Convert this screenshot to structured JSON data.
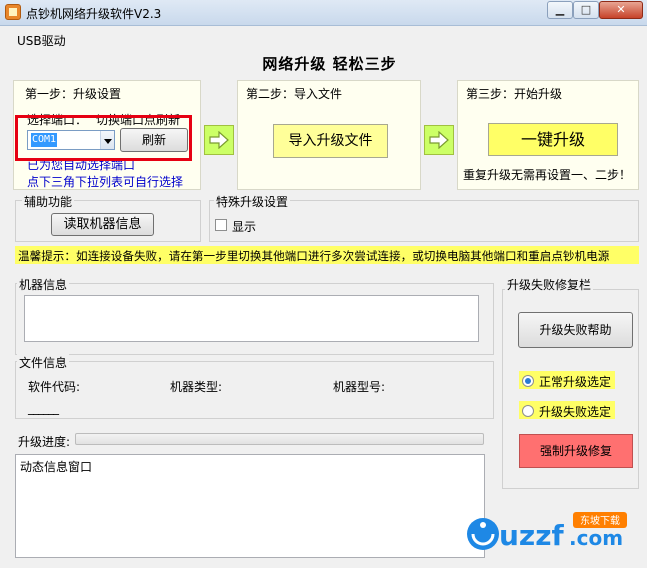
{
  "window": {
    "title": "点钞机网络升级软件V2.3",
    "buttons": [
      "minimize",
      "maximize",
      "close"
    ]
  },
  "menu": {
    "items": [
      "USB驱动"
    ]
  },
  "headline": "网络升级  轻松三步",
  "step1": {
    "title": "第一步：升级设置",
    "port_label": "选择端口：",
    "refresh_hint": "切换端口点刷新",
    "port_value": "COM1",
    "refresh_button": "刷新",
    "auto_select_note": "已为您自动选择端口",
    "dropdown_note": "点下三角下拉列表可自行选择"
  },
  "step2": {
    "title": "第二步：导入文件",
    "import_button": "导入升级文件"
  },
  "step3": {
    "title": "第三步：开始升级",
    "upgrade_button": "一键升级",
    "note": "重复升级无需再设置一、二步！"
  },
  "aux": {
    "title": "辅助功能",
    "read_button": "读取机器信息"
  },
  "special": {
    "title": "特殊升级设置",
    "show_label": "显示",
    "show_checked": false
  },
  "tip": "温馨提示：如连接设备失败，请在第一步里切换其他端口进行多次尝试连接，或切换电脑其他端口和重启点钞机电源",
  "machine_info": {
    "title": "机器信息",
    "content": ""
  },
  "file_info": {
    "title": "文件信息",
    "software_code_label": "软件代码:",
    "machine_type_label": "机器类型:",
    "machine_model_label": "机器型号:",
    "software_code_value": "______"
  },
  "progress": {
    "label": "升级进度:",
    "percent": 0
  },
  "dynamic": {
    "content": "动态信息窗口"
  },
  "repair": {
    "title": "升级失败修复栏",
    "help_button": "升级失败帮助",
    "normal_option": "正常升级选定",
    "fail_option": "升级失败选定",
    "selected": "normal",
    "force_button": "强制升级修复"
  },
  "watermark": {
    "text": "uzzf.com",
    "badge": "东坡下载"
  },
  "colors": {
    "step_bg": "#fffff0",
    "arrow_green": "#ccff66",
    "yellow_button": "#ffff99",
    "highlight": "#ffff66",
    "red_button": "#ff7070",
    "annotation_red": "#e60012",
    "note_blue": "#0000cc"
  }
}
